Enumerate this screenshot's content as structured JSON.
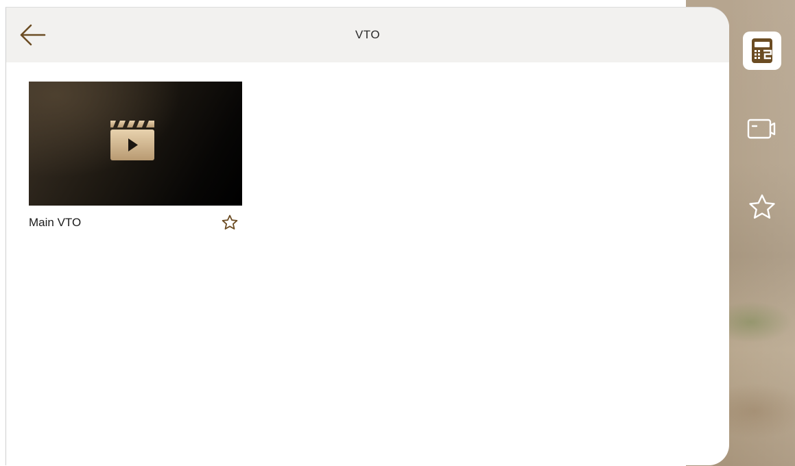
{
  "header": {
    "title": "VTO",
    "back_icon": "arrow-left-icon"
  },
  "devices": [
    {
      "label": "Main VTO",
      "thumbnail_icon": "video-clapper-play-icon",
      "favorite_icon": "star-outline-icon"
    }
  ],
  "sidebar": {
    "items": [
      {
        "icon": "intercom-device-icon",
        "active": true
      },
      {
        "icon": "video-camera-icon",
        "active": false
      },
      {
        "icon": "star-outline-icon",
        "active": false
      }
    ]
  },
  "colors": {
    "accent": "#6b4c23",
    "header_bg": "#f2f1ef",
    "panel_bg": "#ffffff",
    "sidebar_icon": "#ffffff"
  }
}
